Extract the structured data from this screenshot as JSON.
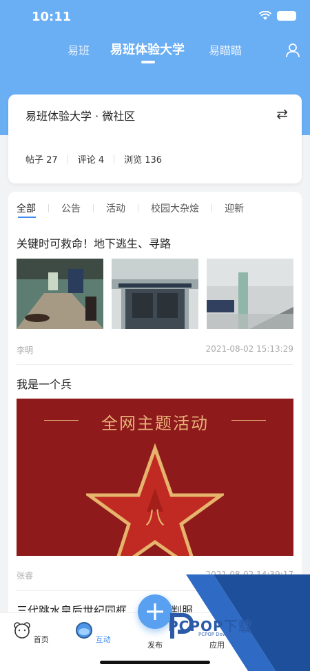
{
  "status_bar": {
    "time": "10:11"
  },
  "top_nav": {
    "tabs": [
      {
        "label": "易班"
      },
      {
        "label": "易班体验大学"
      },
      {
        "label": "易瞄瞄"
      }
    ]
  },
  "community": {
    "title": "易班体验大学 · 微社区",
    "stats": [
      {
        "label": "帖子 27"
      },
      {
        "label": "评论 4"
      },
      {
        "label": "浏览 136"
      }
    ]
  },
  "categories": [
    "全部",
    "公告",
    "活动",
    "校园大杂烩",
    "迎新"
  ],
  "posts": [
    {
      "title": "关键时可救命！地下逃生、寻路",
      "author": "李明",
      "date": "2021-08-02 15:13:29"
    },
    {
      "title": "我是一个兵",
      "banner_text": "全网主题活动",
      "author": "张睿",
      "date": "2021-08-02 14:39:17"
    },
    {
      "title": "三代跳水皇后世纪同框……穿裁判服"
    }
  ],
  "bottom_bar": {
    "items": [
      {
        "label": "首页"
      },
      {
        "label": "互动"
      },
      {
        "label": "发布"
      },
      {
        "label": "应用"
      }
    ]
  },
  "watermark": {
    "text": "PCPOP下载",
    "sub": "PCPOP Download"
  },
  "colors": {
    "header_blue": "#6aaef3",
    "accent": "#3d8ef0",
    "banner_red": "#8e1a1c"
  }
}
